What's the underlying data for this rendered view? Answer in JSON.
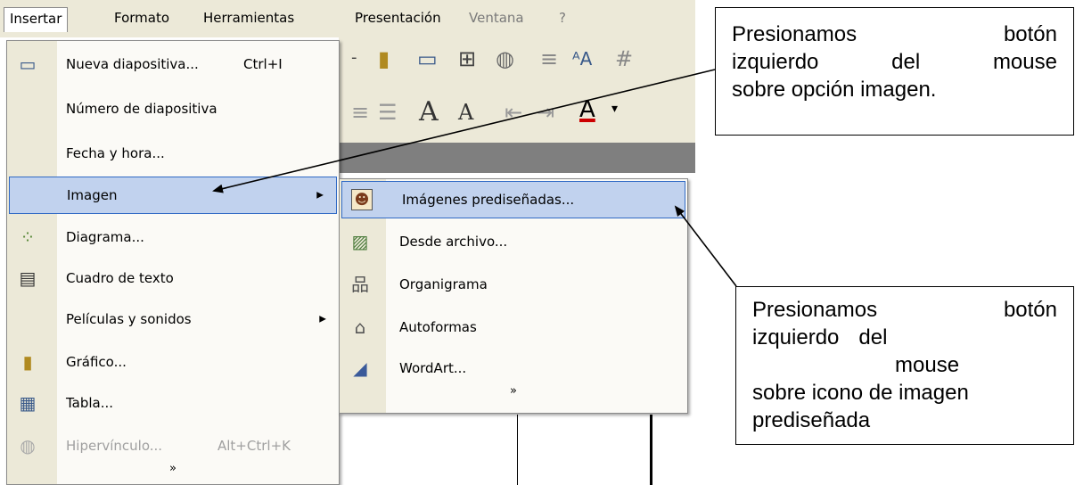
{
  "menubar": {
    "items": [
      "Insertar",
      "Formato",
      "Herramientas",
      "Presentación",
      "Ventana",
      "?"
    ]
  },
  "insert_menu": {
    "items": [
      {
        "label": "Nueva diapositiva...",
        "shortcut": "Ctrl+I",
        "icon": "new-slide-icon"
      },
      {
        "label": "Número de diapositiva"
      },
      {
        "label": "Fecha y hora..."
      },
      {
        "label": "Imagen",
        "submenu": true,
        "highlighted": true
      },
      {
        "label": "Diagrama...",
        "icon": "diagram-icon"
      },
      {
        "label": "Cuadro de texto",
        "icon": "textbox-icon"
      },
      {
        "label": "Películas y sonidos",
        "submenu": true
      },
      {
        "label": "Gráfico...",
        "icon": "chart-icon"
      },
      {
        "label": "Tabla...",
        "icon": "table-icon"
      },
      {
        "label": "Hipervínculo...",
        "shortcut": "Alt+Ctrl+K",
        "icon": "hyperlink-icon",
        "disabled": true
      }
    ],
    "more": "»"
  },
  "image_submenu": {
    "items": [
      {
        "label": "Imágenes prediseñadas...",
        "icon": "clipart-icon",
        "highlighted": true
      },
      {
        "label": "Desde archivo...",
        "icon": "picture-file-icon"
      },
      {
        "label": "Organigrama",
        "icon": "org-chart-icon"
      },
      {
        "label": "Autoformas",
        "icon": "autoshapes-icon"
      },
      {
        "label": "WordArt...",
        "icon": "wordart-icon"
      }
    ],
    "more": "»"
  },
  "callout1": {
    "line1": [
      "Presionamos",
      "botón"
    ],
    "line2": [
      "izquierdo",
      "del",
      "mouse"
    ],
    "line3": "sobre opción imagen."
  },
  "callout2": {
    "line1": [
      "Presionamos",
      "botón"
    ],
    "line2": [
      "izquierdo",
      "del"
    ],
    "line3": "mouse",
    "line4": "sobre icono de imagen",
    "line5": "prediseñada"
  },
  "colors": {
    "menu_highlight": "#c1d2ee",
    "highlight_border": "#316ac5",
    "menu_bg": "#fbfaf6",
    "chrome": "#ece9d8"
  }
}
